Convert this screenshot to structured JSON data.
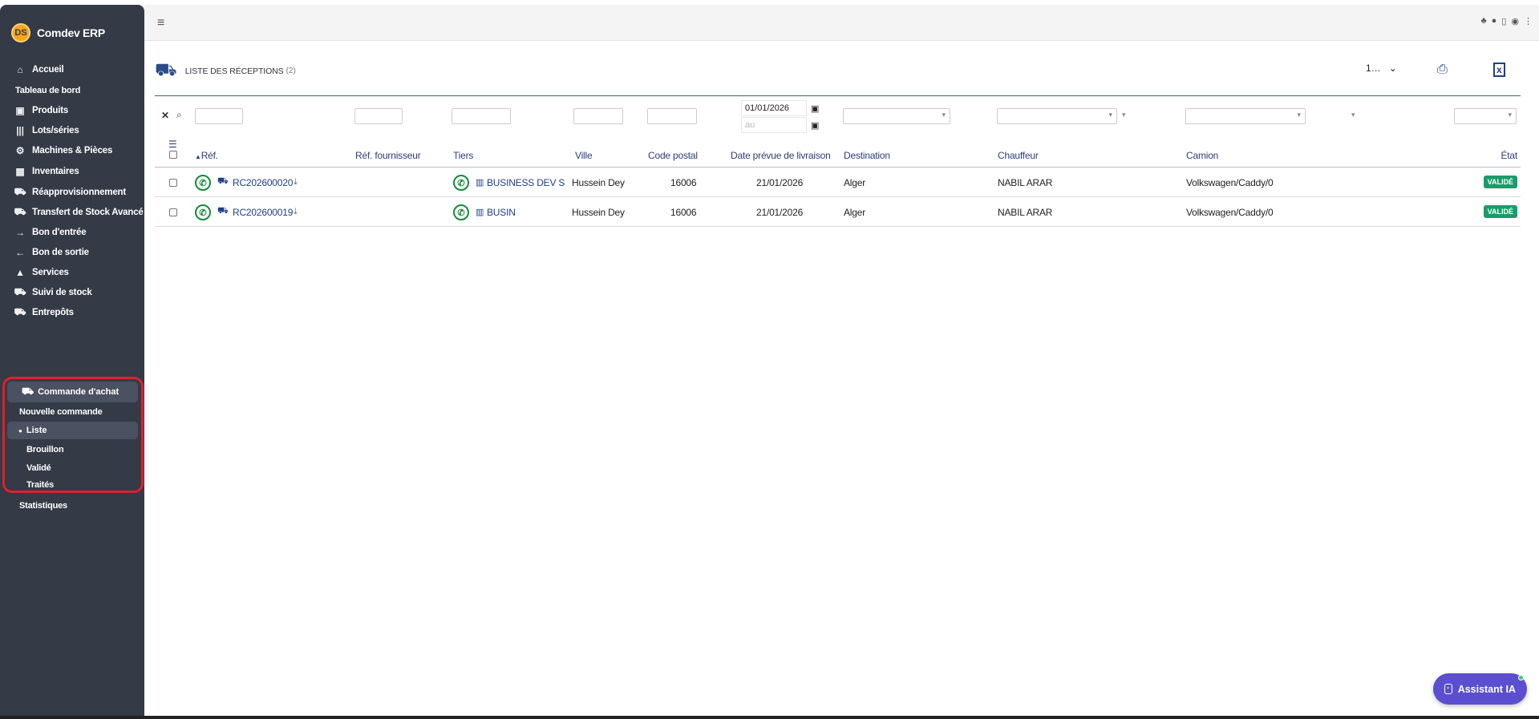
{
  "brand": {
    "logo": "DS",
    "name": "Comdev ERP"
  },
  "sidebar": {
    "items": [
      {
        "icon": "home-icon",
        "glyph": "⌂",
        "label": "Accueil"
      },
      {
        "icon": "",
        "glyph": "",
        "label": "Tableau de bord"
      },
      {
        "icon": "box-icon",
        "glyph": "▣",
        "label": "Produits"
      },
      {
        "icon": "barcode-icon",
        "glyph": "|||",
        "label": "Lots/séries"
      },
      {
        "icon": "gears-icon",
        "glyph": "⚙",
        "label": "Machines & Pièces"
      },
      {
        "icon": "boxes-icon",
        "glyph": "▦",
        "label": "Inventaires"
      },
      {
        "icon": "truck-icon",
        "glyph": "⛟",
        "label": "Réapprovisionnement"
      },
      {
        "icon": "truck-icon",
        "glyph": "⛟",
        "label": "Transfert de Stock Avancé"
      },
      {
        "icon": "arrow-right-icon",
        "glyph": "→",
        "label": "Bon d'entrée"
      },
      {
        "icon": "arrow-left-icon",
        "glyph": "←",
        "label": "Bon de sortie"
      },
      {
        "icon": "bell-service-icon",
        "glyph": "▲",
        "label": "Services"
      },
      {
        "icon": "truck-icon",
        "glyph": "⛟",
        "label": "Suivi de stock"
      },
      {
        "icon": "truck-icon",
        "glyph": "⛟",
        "label": "Entrepôts"
      }
    ],
    "commande": {
      "label": "Commande d'achat",
      "new": "Nouvelle commande",
      "liste": "Liste",
      "brouillon": "Brouillon",
      "valide": "Validé",
      "traites": "Traités",
      "stats": "Statistiques"
    }
  },
  "page": {
    "title": "LISTE DES RÉCEPTIONS",
    "count": "(2)",
    "limit": "1…"
  },
  "filters": {
    "date_from": "01/01/2026",
    "date_to_placeholder": "au"
  },
  "columns": {
    "ref": "Réf.",
    "ref_fournisseur": "Réf. fournisseur",
    "tiers": "Tiers",
    "ville": "Ville",
    "code_postal": "Code postal",
    "date_livraison": "Date prévue de livraison",
    "destination": "Destination",
    "chauffeur": "Chauffeur",
    "camion": "Camion",
    "etat": "État"
  },
  "rows": [
    {
      "ref": "RC202600020",
      "tiers": "BUSINESS DEV S...",
      "ville": "Hussein Dey",
      "code_postal": "16006",
      "date": "21/01/2026",
      "destination": "Alger",
      "chauffeur": "NABIL ARAR",
      "camion": "Volkswagen/Caddy/0",
      "etat": "VALIDÉ"
    },
    {
      "ref": "RC202600019",
      "tiers": "BUSIN",
      "ville": "Hussein Dey",
      "code_postal": "16006",
      "date": "21/01/2026",
      "destination": "Alger",
      "chauffeur": "NABIL ARAR",
      "camion": "Volkswagen/Caddy/0",
      "etat": "VALIDÉ"
    }
  ],
  "assistant": {
    "label": "Assistant IA"
  }
}
